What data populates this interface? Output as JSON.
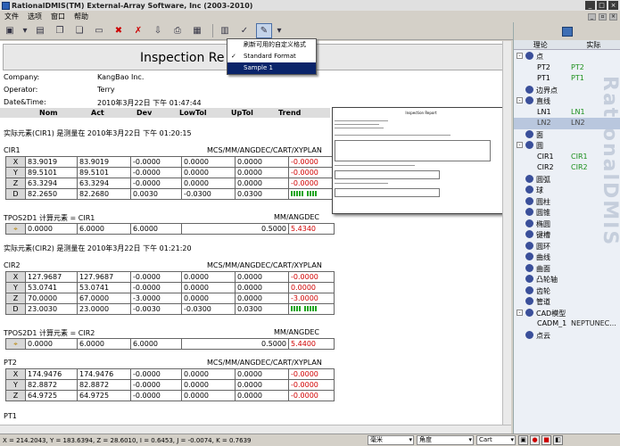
{
  "window": {
    "title": "RationalDMIS(TM) External-Array Software, Inc (2003-2010)"
  },
  "menu": [
    "文件",
    "选项",
    "窗口",
    "帮助"
  ],
  "dropdown": {
    "items": [
      "刷新可用的自定义格式",
      "Standard Format",
      "Sample 1"
    ],
    "checked_index": 1,
    "selected_index": 2
  },
  "report": {
    "title": "Inspection Re",
    "company_label": "Company:",
    "company": "KangBao Inc.",
    "operator_label": "Operator:",
    "operator": "Terry",
    "datetime_label": "Date&Time:",
    "datetime": "2010年3月22日 下午 01:47:44",
    "columns": [
      "Nom",
      "Act",
      "Dev",
      "LowTol",
      "UpTol",
      "Trend"
    ],
    "sections": [
      {
        "heading": "实际元素(CIR1) 是测量在 2010年3月22日 下午 01:20:15",
        "name": "CIR1",
        "format": "MCS/MM/ANGDEC/CART/XYPLAN",
        "rows": [
          [
            "X",
            "83.9019",
            "83.9019",
            "-0.0000",
            "0.0000",
            "0.0000",
            "-0.0000"
          ],
          [
            "Y",
            "89.5101",
            "89.5101",
            "-0.0000",
            "0.0000",
            "0.0000",
            "-0.0000"
          ],
          [
            "Z",
            "63.3294",
            "63.3294",
            "-0.0000",
            "0.0000",
            "0.0000",
            "-0.0000"
          ],
          [
            "D",
            "82.2650",
            "82.2680",
            "0.0030",
            "-0.0300",
            "0.0300",
            ""
          ]
        ],
        "tpos_label": "TPOS2D1 计算元素 =  CIR1",
        "tpos_format": "MM/ANGDEC",
        "tpos_row": [
          "0.0000",
          "6.0000",
          "6.0000",
          "0.5000",
          "5.4340"
        ]
      },
      {
        "heading": "实际元素(CIR2) 是测量在 2010年3月22日 下午 01:21:20",
        "name": "CIR2",
        "format": "MCS/MM/ANGDEC/CART/XYPLAN",
        "rows": [
          [
            "X",
            "127.9687",
            "127.9687",
            "-0.0000",
            "0.0000",
            "0.0000",
            "-0.0000"
          ],
          [
            "Y",
            "53.0741",
            "53.0741",
            "-0.0000",
            "0.0000",
            "0.0000",
            "0.0000"
          ],
          [
            "Z",
            "70.0000",
            "67.0000",
            "-3.0000",
            "0.0000",
            "0.0000",
            "-3.0000"
          ],
          [
            "D",
            "23.0030",
            "23.0000",
            "-0.0030",
            "-0.0300",
            "0.0300",
            ""
          ]
        ],
        "tpos_label": "TPOS2D1 计算元素 =  CIR2",
        "tpos_format": "MM/ANGDEC",
        "tpos_row": [
          "0.0000",
          "6.0000",
          "6.0000",
          "0.5000",
          "5.4400"
        ]
      },
      {
        "name": "PT2",
        "format": "MCS/MM/ANGDEC/CART/XYPLAN",
        "rows": [
          [
            "X",
            "174.9476",
            "174.9476",
            "-0.0000",
            "0.0000",
            "0.0000",
            "-0.0000"
          ],
          [
            "Y",
            "82.8872",
            "82.8872",
            "-0.0000",
            "0.0000",
            "0.0000",
            "-0.0000"
          ],
          [
            "Z",
            "64.9725",
            "64.9725",
            "-0.0000",
            "0.0000",
            "0.0000",
            "-0.0000"
          ]
        ]
      }
    ],
    "last_section": "PT1"
  },
  "panel": {
    "tabs": [
      "理论",
      "实际"
    ],
    "watermark": "RationalDMIS",
    "tree": [
      {
        "label": "点",
        "exp": "-",
        "depth": 0
      },
      {
        "label": "PT2",
        "green": "PT2",
        "depth": 1
      },
      {
        "label": "PT1",
        "green": "PT1",
        "depth": 1
      },
      {
        "label": "边界点",
        "depth": 0
      },
      {
        "label": "直线",
        "exp": "-",
        "depth": 0
      },
      {
        "label": "LN1",
        "green": "LN1",
        "depth": 1
      },
      {
        "label": "LN2",
        "green": "LN2",
        "depth": 1,
        "hl": true
      },
      {
        "label": "面",
        "depth": 0
      },
      {
        "label": "圆",
        "exp": "-",
        "depth": 0
      },
      {
        "label": "CIR1",
        "green": "CIR1",
        "depth": 1
      },
      {
        "label": "CIR2",
        "green": "CIR2",
        "depth": 1
      },
      {
        "label": "圆弧",
        "depth": 0
      },
      {
        "label": "球",
        "depth": 0
      },
      {
        "label": "圆柱",
        "depth": 0
      },
      {
        "label": "圆锥",
        "depth": 0
      },
      {
        "label": "椭圆",
        "depth": 0
      },
      {
        "label": "键槽",
        "depth": 0
      },
      {
        "label": "圆环",
        "depth": 0
      },
      {
        "label": "曲线",
        "depth": 0
      },
      {
        "label": "曲面",
        "depth": 0
      },
      {
        "label": "凸轮轴",
        "depth": 0
      },
      {
        "label": "齿轮",
        "depth": 0
      },
      {
        "label": "管道",
        "depth": 0
      },
      {
        "label": "CAD模型",
        "exp": "-",
        "depth": 0
      },
      {
        "label": "CADM_1",
        "green": "NEPTUNEC...",
        "dark": true,
        "depth": 1
      },
      {
        "label": "点云",
        "depth": 0
      }
    ]
  },
  "status": {
    "coords": "X = 214.2043, Y = 183.6394, Z = 28.6010, I = 0.6453, J = -0.0074, K = 0.7639",
    "unit": "毫米",
    "angle": "角度",
    "coord_sys": "Cart"
  }
}
